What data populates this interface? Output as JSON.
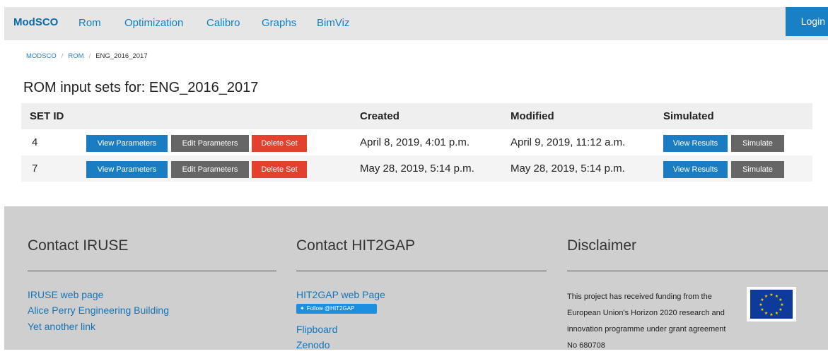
{
  "nav": {
    "brand": "ModSCO",
    "links": [
      "Rom",
      "Optimization",
      "Calibro",
      "Graphs",
      "BimViz"
    ],
    "login": "Login"
  },
  "breadcrumb": [
    "MODSCO",
    "ROM",
    "ENG_2016_2017"
  ],
  "page_title": "ROM input sets for: ENG_2016_2017",
  "table": {
    "headers": [
      "SET ID",
      "Created",
      "Modified",
      "Simulated"
    ],
    "rows": [
      {
        "id": "4",
        "created": "April 8, 2019, 4:01 p.m.",
        "modified": "April 9, 2019, 11:12 a.m."
      },
      {
        "id": "7",
        "created": "May 28, 2019, 5:14 p.m.",
        "modified": "May 28, 2019, 5:14 p.m."
      }
    ],
    "buttons": {
      "view_parameters": "View Parameters",
      "edit_parameters": "Edit Parameters",
      "delete_set": "Delete Set",
      "view_results": "View Results",
      "simulate": "Simulate"
    }
  },
  "footer": {
    "contact_iruse": {
      "title": "Contact IRUSE",
      "links": [
        "IRUSE web page",
        "Alice Perry Engineering Building",
        "Yet another link"
      ]
    },
    "contact_hit2gap": {
      "title": "Contact HIT2GAP",
      "web_page": "HIT2GAP web Page",
      "twitter": "Follow @HIT2GAP",
      "links": [
        "Flipboard",
        "Zenodo"
      ]
    },
    "disclaimer": {
      "title": "Disclaimer",
      "text": "This project has received funding from the European Union's Horizon 2020 research and innovation programme under grant agreement No 680708"
    }
  },
  "colors": {
    "primary": "#1a7dc3",
    "danger": "#e4402f",
    "secondary": "#666666",
    "footer_bg": "#cfcfcf",
    "nav_bg": "#e6e6e6"
  }
}
